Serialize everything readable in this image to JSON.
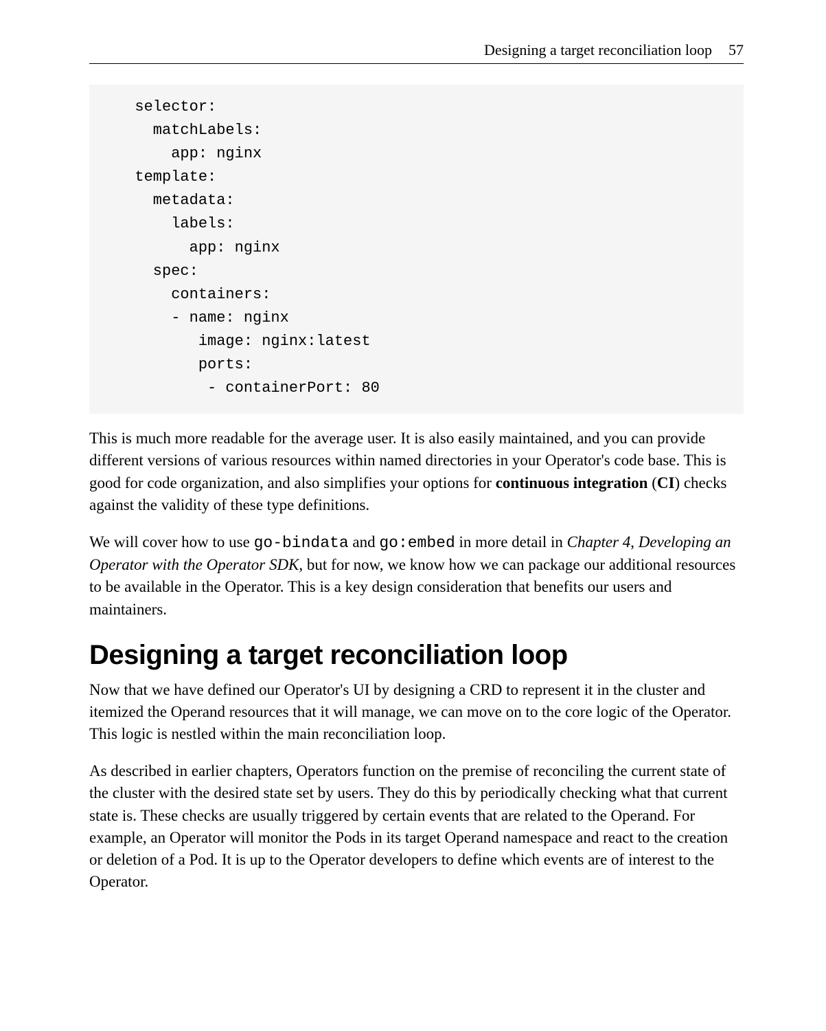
{
  "header": {
    "title": "Designing a target reconciliation loop",
    "page_number": "57"
  },
  "code": {
    "l1": "  selector:",
    "l2": "    matchLabels:",
    "l3": "      app: nginx",
    "l4": "  template:",
    "l5": "    metadata:",
    "l6": "      labels:",
    "l7": "        app: nginx",
    "l8": "    spec:",
    "l9": "      containers:",
    "l10": "      - name: nginx",
    "l11": "         image: nginx:latest",
    "l12": "         ports:",
    "l13": "          - containerPort: 80"
  },
  "p1": {
    "t1": "This is much more readable for the average user. It is also easily maintained, and you can provide different versions of various resources within named directories in your Operator's code base. This is good for code organization, and also simplifies your options for ",
    "b1": "continuous integration",
    "t2": " (",
    "b2": "CI",
    "t3": ") checks against the validity of these type definitions."
  },
  "p2": {
    "t1": "We will cover how to use ",
    "c1": "go-bindata",
    "t2": " and ",
    "c2": "go:embed",
    "t3": " in more detail in ",
    "i1": "Chapter 4",
    "t4": ", ",
    "i2": "Developing an Operator with the Operator SDK",
    "t5": ", but for now, we know how we can package our additional resources to be available in the Operator. This is a key design consideration that benefits our users and maintainers."
  },
  "heading": "Designing a target reconciliation loop",
  "p3": "Now that we have defined our Operator's UI by designing a CRD to represent it in the cluster and itemized the Operand resources that it will manage, we can move on to the core logic of the Operator. This logic is nestled within the main reconciliation loop.",
  "p4": "As described in earlier chapters, Operators function on the premise of reconciling the current state of the cluster with the desired state set by users. They do this by periodically checking what that current state is. These checks are usually triggered by certain events that are related to the Operand. For example, an Operator will monitor the Pods in its target Operand namespace and react to the creation or deletion of a Pod. It is up to the Operator developers to define which events are of interest to the Operator."
}
